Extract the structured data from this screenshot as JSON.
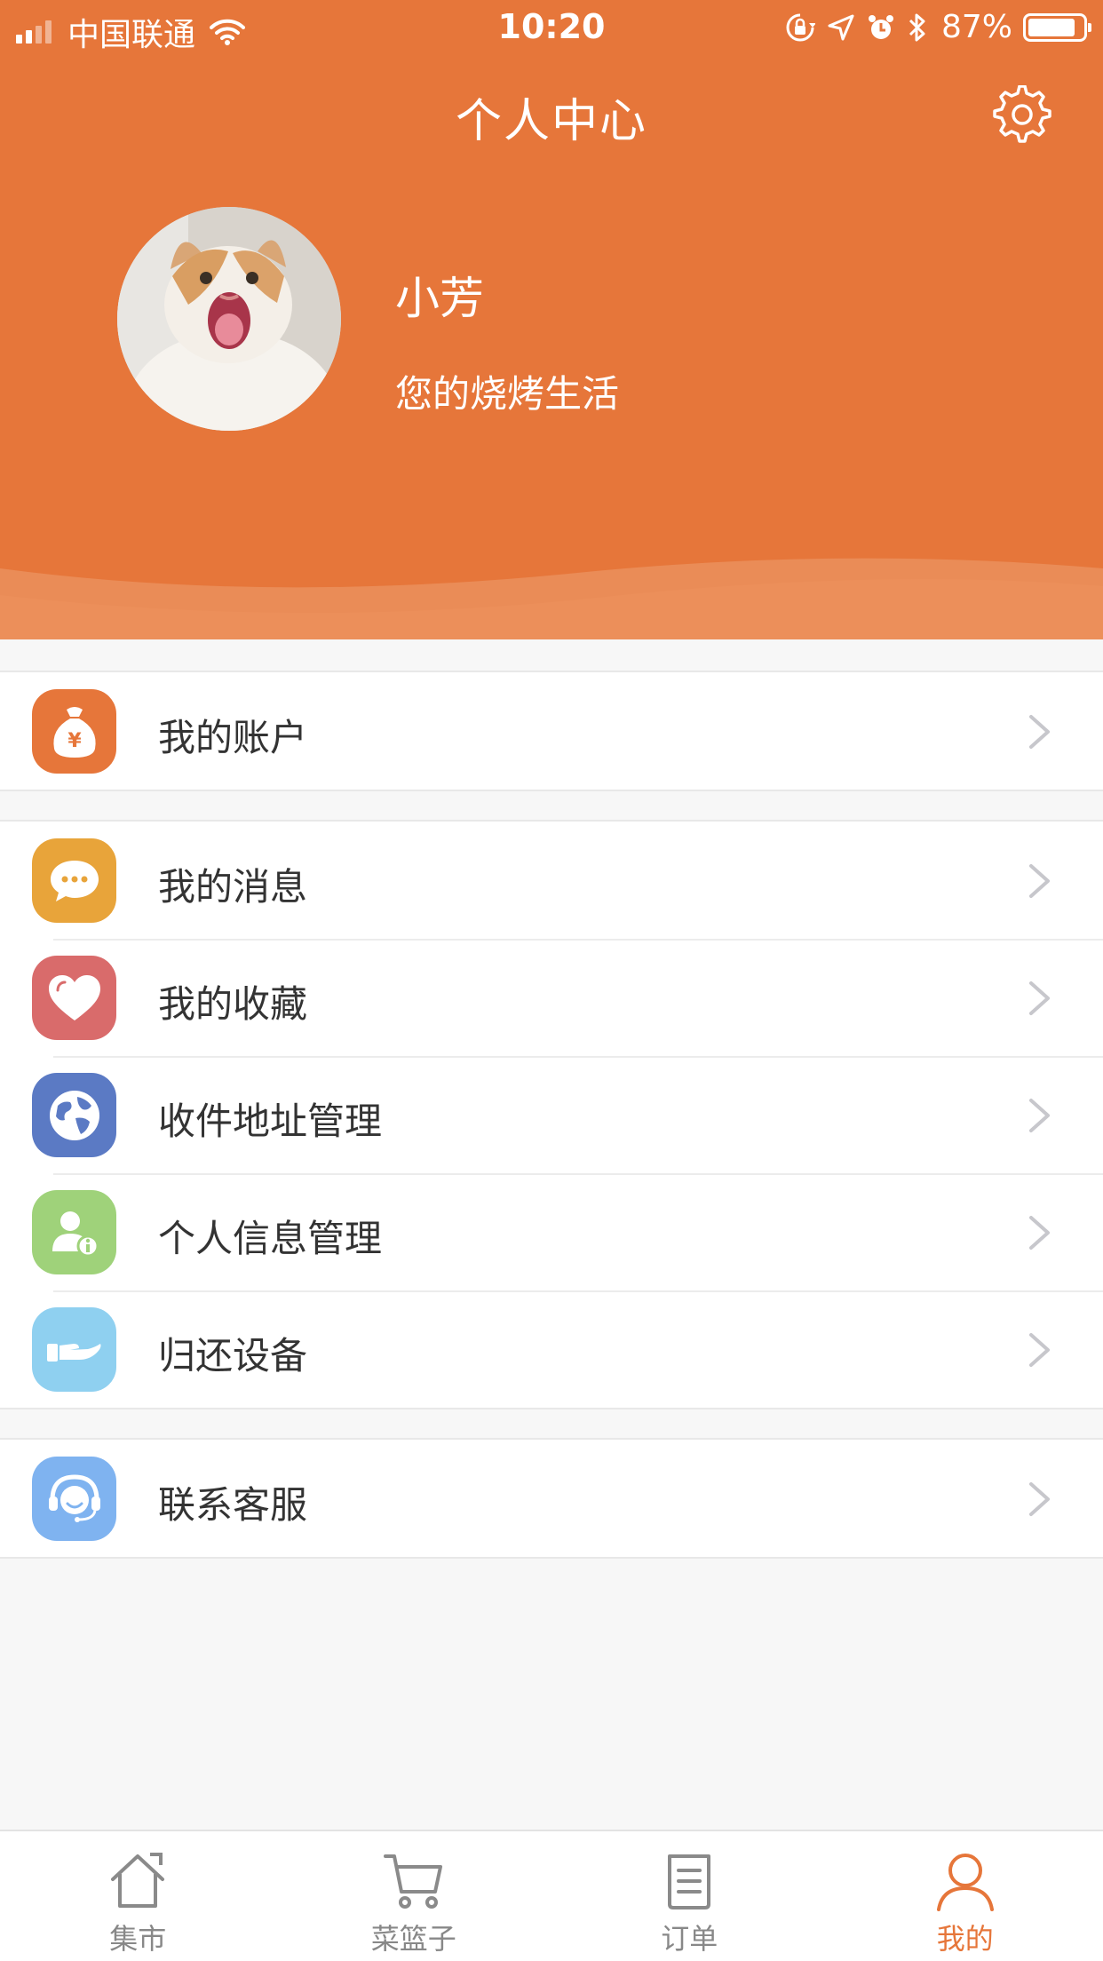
{
  "status_bar": {
    "carrier": "中国联通",
    "time": "10:20",
    "battery": "87%",
    "battery_level": 0.87,
    "icons": [
      "signal-icon",
      "wifi-icon",
      "rotation-lock-icon",
      "location-icon",
      "alarm-icon",
      "bluetooth-icon",
      "battery-icon"
    ]
  },
  "header": {
    "title": "个人中心",
    "settings_icon": "gear-icon",
    "background_color": "#e6763a"
  },
  "profile": {
    "name": "小芳",
    "slogan": "您的烧烤生活",
    "avatar": "cat-photo"
  },
  "menu": {
    "groups": [
      [
        {
          "label": "我的账户",
          "icon": "money-bag-icon",
          "color": "#e6763a"
        }
      ],
      [
        {
          "label": "我的消息",
          "icon": "chat-bubble-icon",
          "color": "#e8a43a"
        },
        {
          "label": "我的收藏",
          "icon": "heart-icon",
          "color": "#d96b6b"
        },
        {
          "label": "收件地址管理",
          "icon": "globe-icon",
          "color": "#5b7ac4"
        },
        {
          "label": "个人信息管理",
          "icon": "user-info-icon",
          "color": "#9fd27a"
        },
        {
          "label": "归还设备",
          "icon": "hand-icon",
          "color": "#8fd0f0"
        }
      ],
      [
        {
          "label": "联系客服",
          "icon": "headset-icon",
          "color": "#7fb3f0"
        }
      ]
    ]
  },
  "tabbar": {
    "active_color": "#e6763a",
    "items": [
      {
        "label": "集市",
        "icon": "house-icon"
      },
      {
        "label": "菜篮子",
        "icon": "cart-icon"
      },
      {
        "label": "订单",
        "icon": "document-icon"
      },
      {
        "label": "我的",
        "icon": "person-icon",
        "active": true
      }
    ]
  }
}
